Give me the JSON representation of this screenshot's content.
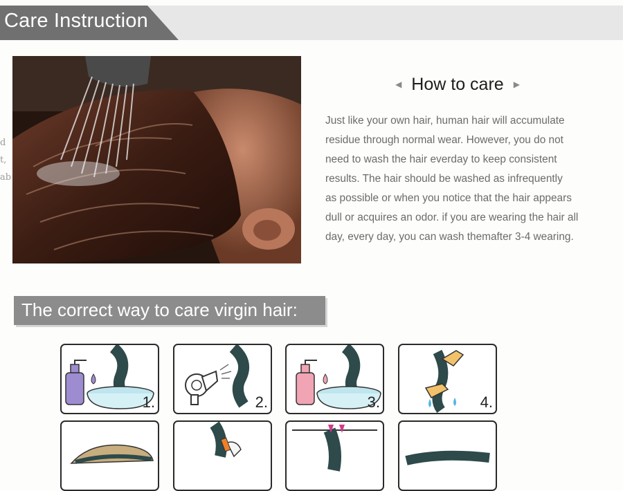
{
  "header": {
    "title": "Care Instruction"
  },
  "side_fragments": [
    "d",
    "t,",
    "ab"
  ],
  "how_to_care": {
    "title": "How to care",
    "left_arrow_icon": "triangle-left-icon",
    "right_arrow_icon": "triangle-right-icon",
    "lines": [
      "Just like your own hair, human hair will accumulate",
      "residue through normal wear. However, you do not",
      "need to wash the hair everday to keep consistent",
      "results. The hair should be washed as infrequently",
      "as possible or when you notice that the hair appears",
      "dull or acquires an odor. if you are wearing the hair all",
      "day, every day, you can wash themafter 3-4 wearing."
    ]
  },
  "subheading": "The correct way to care virgin hair:",
  "steps": [
    {
      "number": "1.",
      "icon": "shampoo-basin-icon"
    },
    {
      "number": "2.",
      "icon": "hair-dryer-icon"
    },
    {
      "number": "3.",
      "icon": "shampoo-basin-icon"
    },
    {
      "number": "4.",
      "icon": "hand-wring-icon"
    },
    {
      "number": "",
      "icon": "hair-bundle-icon"
    },
    {
      "number": "",
      "icon": "comb-icon"
    },
    {
      "number": "",
      "icon": "hanging-clips-icon"
    },
    {
      "number": "",
      "icon": "hair-bundle-icon"
    }
  ],
  "colors": {
    "header_tab": "#707070",
    "header_band": "#e7e7e7",
    "subheading_bg": "#8c8c8c",
    "body_text": "#6b6b6b"
  }
}
